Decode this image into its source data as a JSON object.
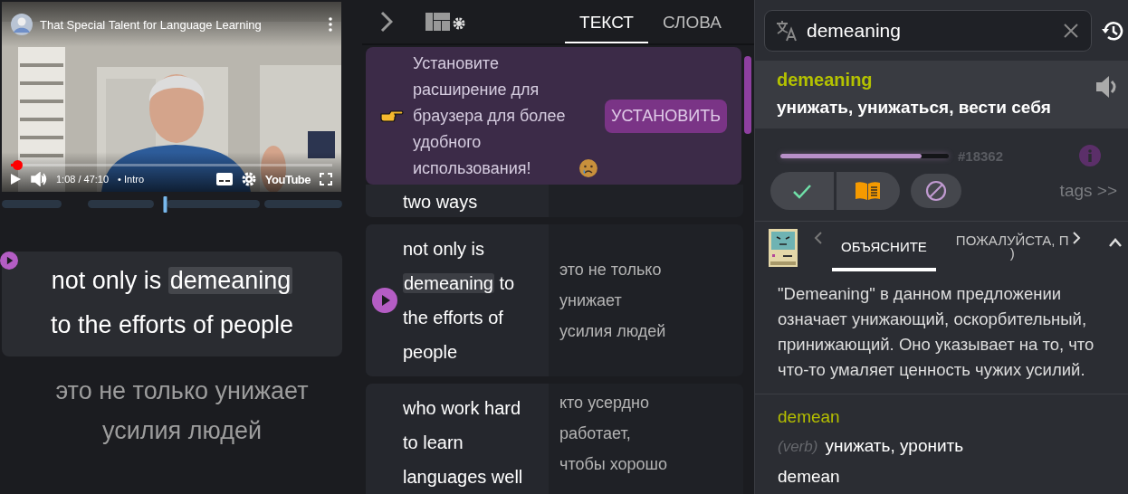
{
  "video": {
    "title": "That Special Talent for Language Learning",
    "time": "1:08 / 47:10",
    "chapter": "• Intro",
    "logo": "YouTube",
    "progress": {
      "level": 0.02
    }
  },
  "timeline": {
    "level": 0.48
  },
  "subtitle": {
    "parts": [
      {
        "text": "not only is ",
        "highlighted": false
      },
      {
        "text": "demeaning",
        "highlighted": true
      },
      {
        "text": " to the efforts of people",
        "highlighted": false
      }
    ],
    "translation": "это не только унижает усилия людей"
  },
  "toolbar": {
    "tabs": [
      {
        "label": "ТЕКСТ",
        "selected": true
      },
      {
        "label": "СЛОВА",
        "selected": false
      }
    ]
  },
  "banner": {
    "message": "Установите расширение для браузера для более удобного использования!",
    "button": "УСТАНОВИТЬ"
  },
  "transcript": {
    "rows": [
      {
        "parts": [
          {
            "text": "two ways",
            "highlighted": false
          }
        ],
        "playing": false
      },
      {
        "parts": [
          {
            "text": "not only is ",
            "highlighted": false
          },
          {
            "text": "demeaning",
            "highlighted": true
          },
          {
            "text": " to the efforts of people",
            "highlighted": false
          }
        ],
        "translation": "это не только унижает усилия людей",
        "playing": true
      },
      {
        "parts": [
          {
            "text": "who work hard to learn languages well",
            "highlighted": false
          }
        ],
        "translation": "кто усердно работает, чтобы хорошо",
        "playing": false
      }
    ]
  },
  "dictionary": {
    "search": {
      "value": "demeaning"
    },
    "result": {
      "word": "demeaning",
      "translation": "унижать, унижаться, вести себя"
    },
    "rank": {
      "level": 0.84,
      "label": "#18362"
    },
    "actions": [
      {
        "kind": "known"
      },
      {
        "kind": "learning"
      },
      {
        "kind": "ignore"
      }
    ],
    "tags_link": "tags >>",
    "ai": {
      "tabs": [
        {
          "label_lines": [
            "ОБЪЯСНИТЕ"
          ],
          "selected": true
        },
        {
          "label_lines": [
            "ПОЖАЛУЙСТА, П",
            ")"
          ],
          "selected": false
        }
      ],
      "explanation": "\"Demeaning\" в данном предложении означает унижающий, оскорбительный, принижающий. Оно указывает на то, что что-то умаляет ценность чужих усилий."
    },
    "forms": [
      {
        "word": "demean",
        "pos": "(verb)",
        "translation": "унижать, уронить"
      }
    ],
    "lemma": "demean"
  }
}
